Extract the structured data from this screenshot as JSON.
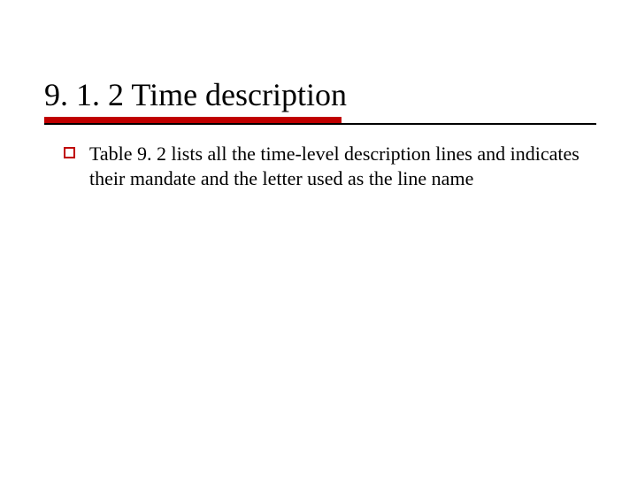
{
  "slide": {
    "title": "9. 1. 2 Time description",
    "bullets": [
      {
        "icon": "hollow-square-icon",
        "text": "Table 9. 2 lists all the time-level description lines and indicates their mandate and the letter used as the line name"
      }
    ]
  },
  "colors": {
    "accent": "#c00000",
    "text": "#000000",
    "background": "#ffffff"
  }
}
